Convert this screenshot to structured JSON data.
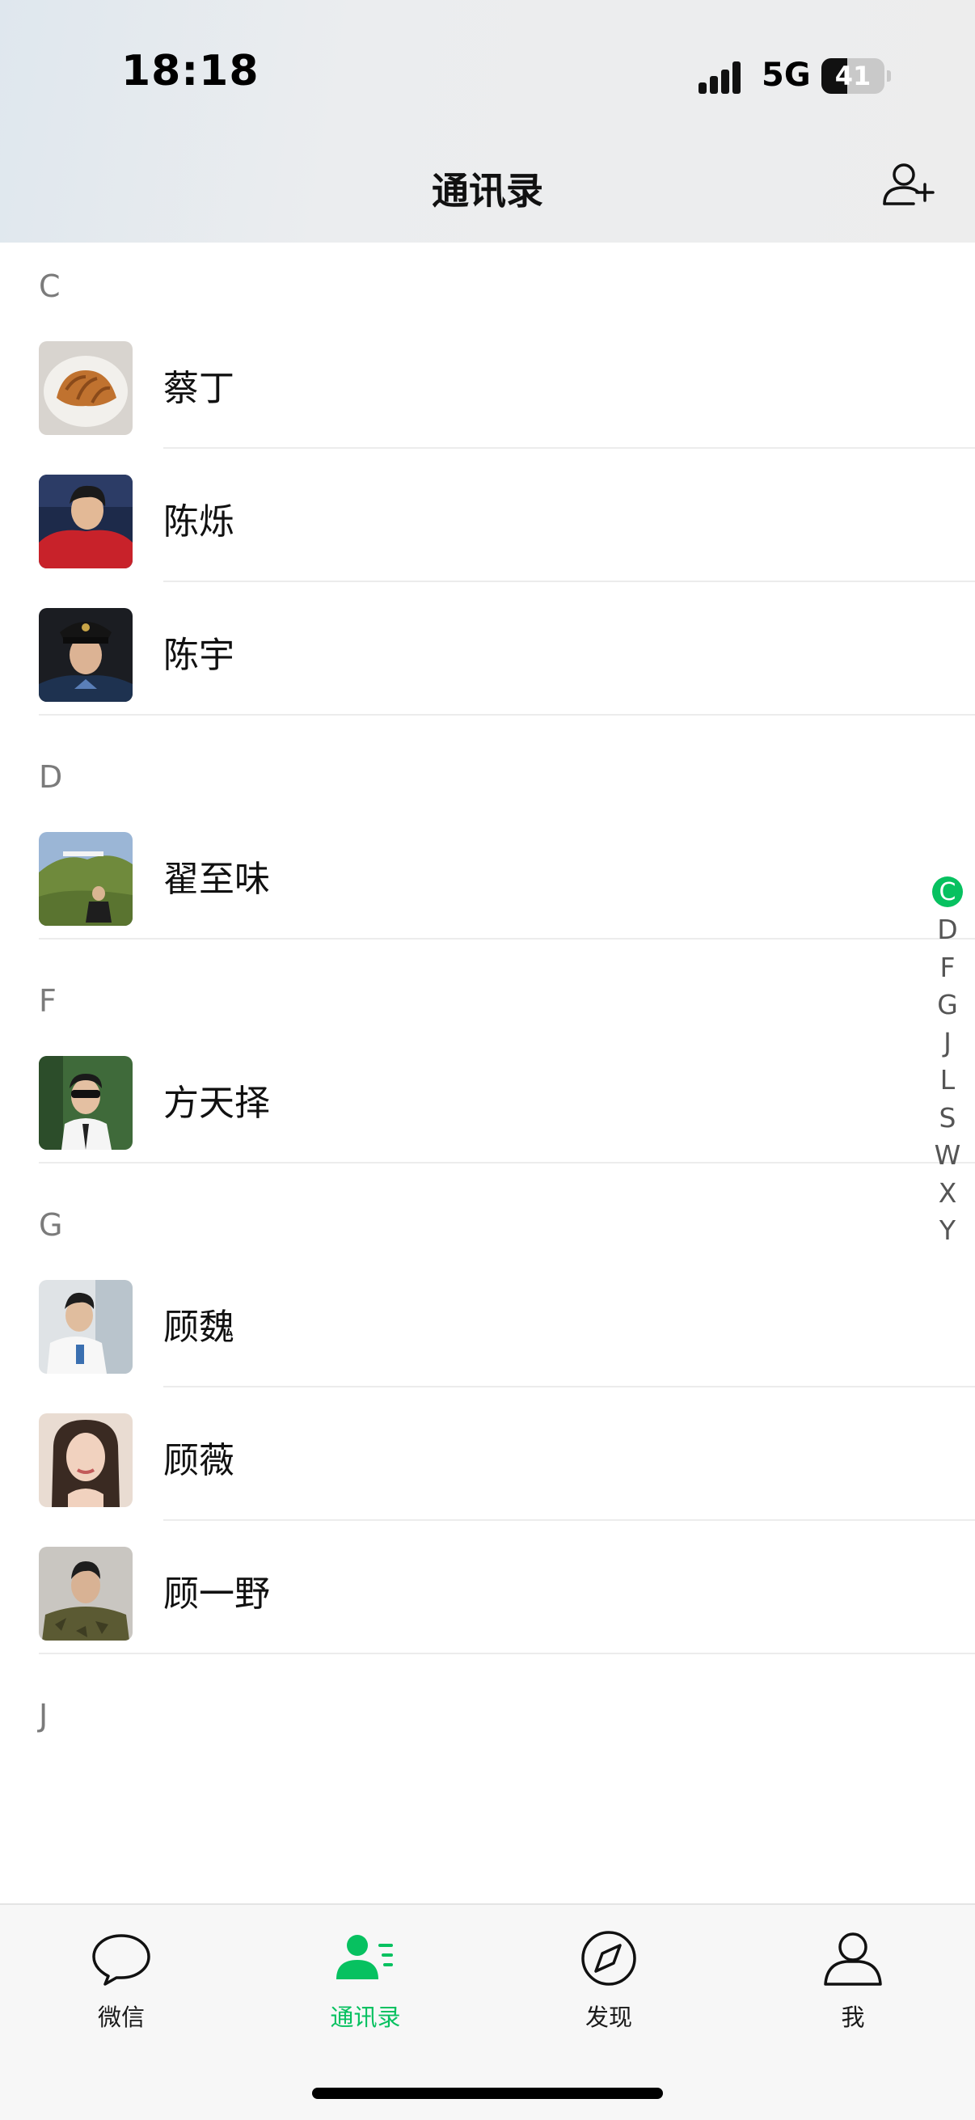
{
  "status_bar": {
    "time": "18:18",
    "network": "5G",
    "battery": "41",
    "battery_level": 0.41
  },
  "nav": {
    "title": "通讯录",
    "add_friend_icon": "add-contact-icon"
  },
  "sections": [
    {
      "letter": "C",
      "contacts": [
        {
          "name": "蔡丁",
          "avatar": "croissant-photo"
        },
        {
          "name": "陈烁",
          "avatar": "man-red-jacket-photo"
        },
        {
          "name": "陈宇",
          "avatar": "man-police-cap-photo"
        }
      ]
    },
    {
      "letter": "D",
      "contacts": [
        {
          "name": "翟至味",
          "avatar": "hollywood-hill-photo"
        }
      ]
    },
    {
      "letter": "F",
      "contacts": [
        {
          "name": "方天择",
          "avatar": "man-sunglasses-photo"
        }
      ]
    },
    {
      "letter": "G",
      "contacts": [
        {
          "name": "顾魏",
          "avatar": "man-white-coat-photo"
        },
        {
          "name": "顾薇",
          "avatar": "woman-portrait-photo"
        },
        {
          "name": "顾一野",
          "avatar": "man-camouflage-photo"
        }
      ]
    },
    {
      "letter": "J",
      "contacts": []
    }
  ],
  "index_bar": {
    "letters": [
      "C",
      "D",
      "F",
      "G",
      "J",
      "L",
      "S",
      "W",
      "X",
      "Y"
    ],
    "active": "C",
    "accent": "#07c160"
  },
  "tab_bar": {
    "tabs": [
      {
        "label": "微信",
        "icon": "chat-bubble-icon"
      },
      {
        "label": "通讯录",
        "icon": "contacts-icon"
      },
      {
        "label": "发现",
        "icon": "compass-icon"
      },
      {
        "label": "我",
        "icon": "person-icon"
      }
    ],
    "active_index": 1
  },
  "colors": {
    "accent": "#07c160",
    "section_header": "#7b7b7b",
    "divider": "#ececec"
  }
}
